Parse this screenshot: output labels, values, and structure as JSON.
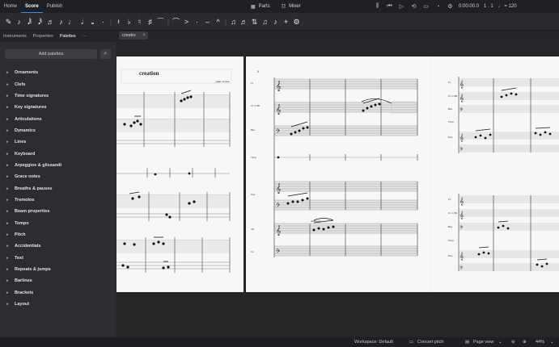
{
  "menubar": {
    "tabs": [
      "Home",
      "Score",
      "Publish"
    ],
    "active_tab": "Score",
    "parts_label": "Parts",
    "mixer_label": "Mixer",
    "time": "0:00:00.0",
    "position": "1 . 1",
    "tempo": "♩ = 120"
  },
  "toolbar": {
    "icons": [
      "pen-input-icon",
      "note-input-icon",
      "64th-note-icon",
      "32nd-note-icon",
      "16th-note-icon",
      "eighth-note-icon",
      "quarter-note-icon",
      "half-note-icon",
      "whole-note-icon",
      "dot-icon",
      "rest-icon",
      "flat-icon",
      "natural-icon",
      "sharp-icon",
      "tie-icon",
      "slur-icon",
      "accent-icon",
      "staccato-icon",
      "tenuto-icon",
      "marcato-icon",
      "tuplet-icon",
      "flip-direction-icon",
      "add-icon",
      "settings-icon"
    ]
  },
  "panel": {
    "tabs": [
      "Instruments",
      "Properties",
      "Palettes"
    ],
    "active_tab": "Palettes",
    "add_palettes_label": "Add palettes",
    "palettes": [
      "Ornaments",
      "Clefs",
      "Time signatures",
      "Key signatures",
      "Articulations",
      "Dynamics",
      "Lines",
      "Keyboard",
      "Arpeggios & glissandi",
      "Grace notes",
      "Breaths & pauses",
      "Tremolos",
      "Beam properties",
      "Tempo",
      "Pitch",
      "Accidentials",
      "Text",
      "Repeats & jumps",
      "Barlines",
      "Brackets",
      "Layout"
    ]
  },
  "document": {
    "tab_label": "creatio",
    "score_title": "creation",
    "composer": "pajan sroban",
    "page2_number": "8",
    "page2_staff_labels": [
      "Fl.",
      "Cl. in Bb",
      "Bsn.",
      "Timp.",
      "Pno.",
      "",
      "Vln.",
      "Vc."
    ],
    "page3_staff_labels": [
      "Fl.",
      "Cl. in Bb",
      "Bsn.",
      "Timp.",
      "Pno.",
      "",
      "Fl.",
      "Cl. in Bb",
      "Bsn.",
      "Timp.",
      "Pno.",
      ""
    ],
    "annotation": "Allmässiig"
  },
  "statusbar": {
    "workspace": "Workspace: Default",
    "concert_pitch": "Concert pitch",
    "page_view": "Page view",
    "zoom": "44%"
  }
}
